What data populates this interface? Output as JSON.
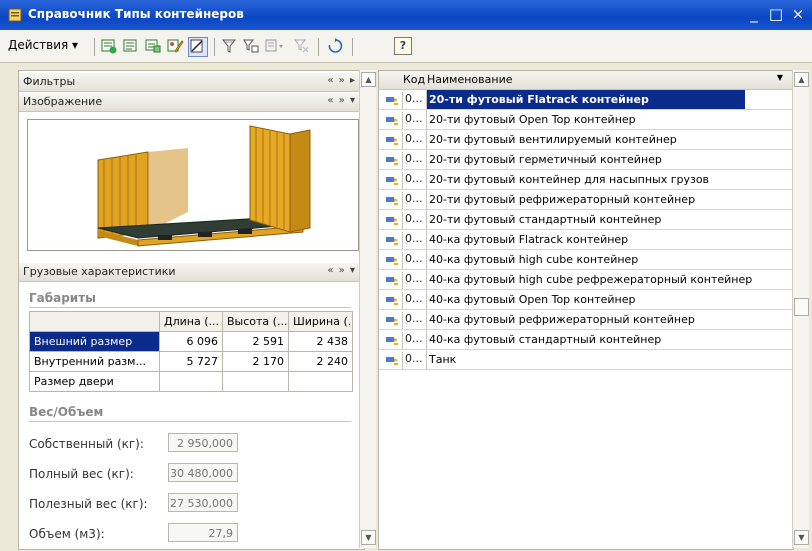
{
  "window": {
    "title": "Справочник Типы контейнеров",
    "controls": [
      "_",
      "□",
      "×"
    ]
  },
  "toolbar": {
    "actions_label": "Действия ▾",
    "help_label": "?"
  },
  "left": {
    "filters_label": "Фильтры",
    "filters_ctl": "« » ▸",
    "image_label": "Изображение",
    "image_ctl": "« » ▾",
    "cargo_label": "Грузовые характеристики",
    "cargo_ctl": "« » ▾",
    "dims_group": "Габариты",
    "dims_headers": [
      "Длина (...",
      "Высота (...",
      "Ширина (..."
    ],
    "dims_rows": [
      {
        "label": "Внешний размер",
        "l": "6 096",
        "h": "2 591",
        "w": "2 438"
      },
      {
        "label": "Внутренний разм...",
        "l": "5 727",
        "h": "2 170",
        "w": "2 240"
      },
      {
        "label": "Размер двери",
        "l": "",
        "h": "",
        "w": ""
      }
    ],
    "weight_group": "Вес/Объем",
    "fields": [
      {
        "label": "Собственный (кг):",
        "value": "2 950,000"
      },
      {
        "label": "Полный вес (кг):",
        "value": "30 480,000"
      },
      {
        "label": "Полезный вес (кг):",
        "value": "27 530,000"
      },
      {
        "label": "Объем (м3):",
        "value": "27,9"
      }
    ]
  },
  "list": {
    "col_code": "Код",
    "col_name": "Наименование",
    "rows": [
      {
        "code": "0...",
        "name": "20-ти футовый Flatrack контейнер"
      },
      {
        "code": "0...",
        "name": "20-ти футовый Open Top контейнер"
      },
      {
        "code": "0...",
        "name": "20-ти футовый вентилируемый контейнер"
      },
      {
        "code": "0...",
        "name": "20-ти футовый герметичный контейнер"
      },
      {
        "code": "0...",
        "name": "20-ти футовый контейнер для насыпных грузов"
      },
      {
        "code": "0...",
        "name": "20-ти футовый рефрижераторный контейнер"
      },
      {
        "code": "0...",
        "name": "20-ти футовый стандартный контейнер"
      },
      {
        "code": "0...",
        "name": "40-ка футовый Flatrack контейнер"
      },
      {
        "code": "0...",
        "name": "40-ка футовый high cube контейнер"
      },
      {
        "code": "0...",
        "name": "40-ка футовый high cube рефрежераторный контейнер"
      },
      {
        "code": "0...",
        "name": "40-ка футовый Open Top контейнер"
      },
      {
        "code": "0...",
        "name": "40-ка футовый рефрижераторный контейнер"
      },
      {
        "code": "0...",
        "name": "40-ка футовый стандартный контейнер"
      },
      {
        "code": "0...",
        "name": "Танк"
      }
    ]
  },
  "colors": {
    "title_bar": "#0a46c3",
    "selection": "#0a2a8c",
    "container": "#e0a322"
  }
}
